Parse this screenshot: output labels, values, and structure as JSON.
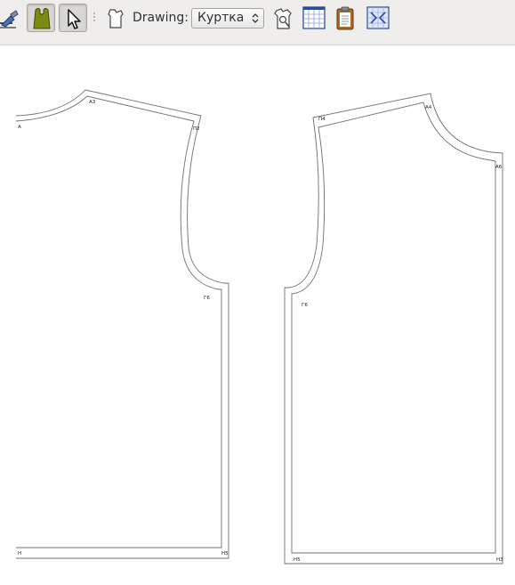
{
  "toolbar": {
    "drawing_label": "Drawing:",
    "drawing_select": {
      "selected": "Куртка"
    },
    "buttons": [
      {
        "icon": "draw-mode-icon",
        "active": false
      },
      {
        "icon": "details-mode-icon",
        "active": true
      },
      {
        "icon": "arrow-pointer-icon",
        "active": true
      },
      {
        "icon": "new-pattern-piece-icon",
        "active": false
      },
      {
        "icon": "piece-properties-icon",
        "active": false
      },
      {
        "icon": "grid-layout-icon",
        "active": false
      },
      {
        "icon": "clipboard-icon",
        "active": false
      },
      {
        "icon": "union-details-icon",
        "active": false
      }
    ]
  },
  "pattern_pieces": [
    {
      "name": "back-piece",
      "points": [
        "А",
        "А3",
        "П2",
        "Г6",
        "Н",
        "Н5"
      ]
    },
    {
      "name": "front-piece",
      "points": [
        "П4",
        "А4",
        "А6",
        "Г6",
        "Н5",
        "Н3"
      ]
    }
  ],
  "colors": {
    "toolbar_bg": "#efeeec",
    "canvas_bg": "#ffffff",
    "outline": "#6f6f6f",
    "details_icon": "#6b7c12",
    "grid_icon": "#2a4d9b",
    "clipboard_icon": "#a86a26"
  }
}
